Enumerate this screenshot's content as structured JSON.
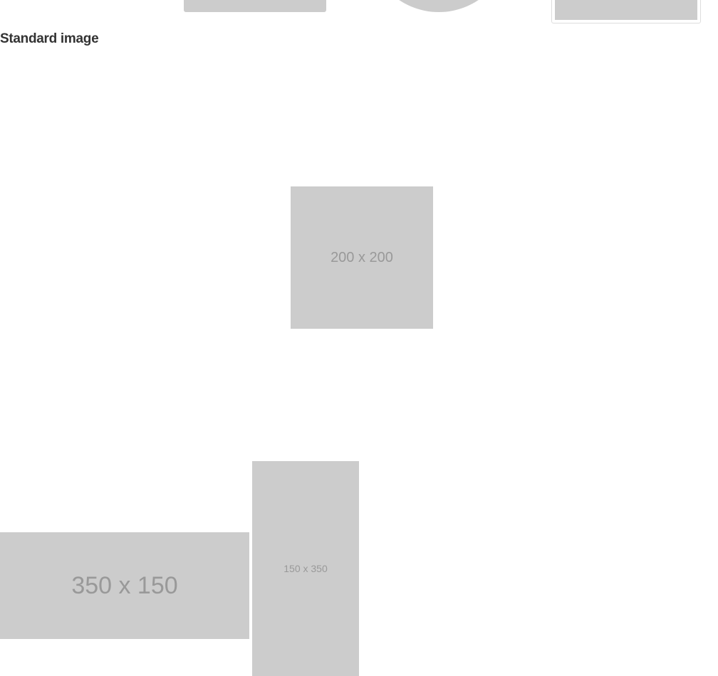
{
  "section": {
    "heading": "Standard image"
  },
  "images": {
    "square_label": "200 x 200",
    "wide_label": "350 x 150",
    "tall_label": "150 x 350"
  },
  "colors": {
    "placeholder_bg": "#cccccc",
    "placeholder_text": "#999999",
    "heading_text": "#333333",
    "thumbnail_border": "#dddddd"
  }
}
